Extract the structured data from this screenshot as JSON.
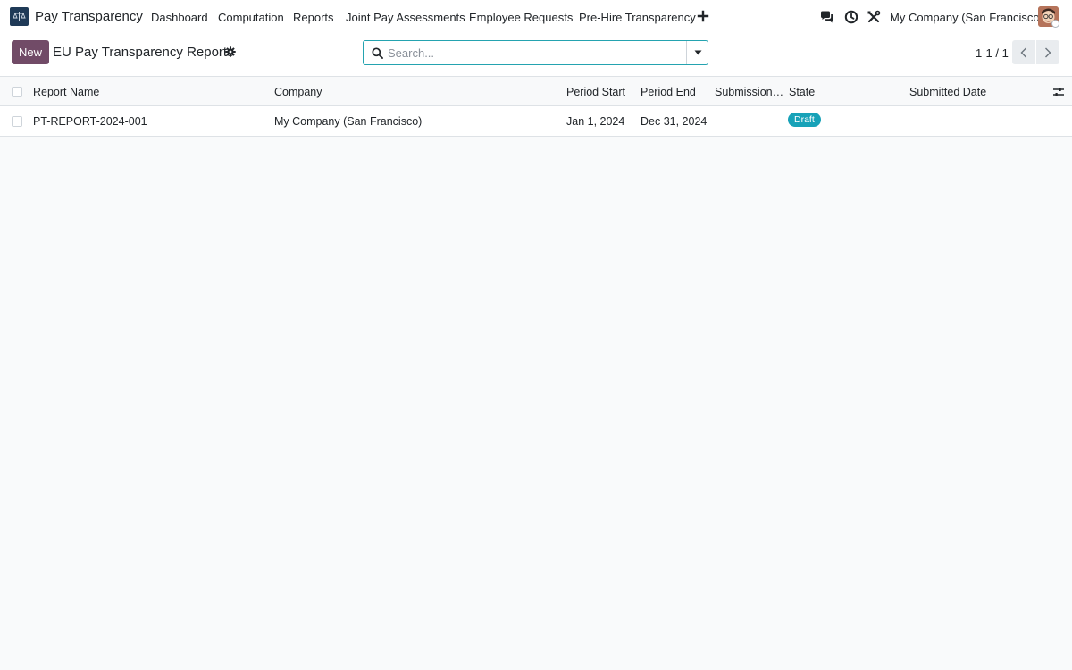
{
  "app": {
    "name": "Pay Transparency",
    "logo_icon": "scales-icon"
  },
  "menu": {
    "items": [
      {
        "label": "Dashboard"
      },
      {
        "label": "Computation"
      },
      {
        "label": "Reports"
      },
      {
        "label": "Joint Pay Assessments"
      },
      {
        "label": "Employee Requests"
      },
      {
        "label": "Pre-Hire Transparency"
      }
    ]
  },
  "systray": {
    "company": "My Company (San Francisco)"
  },
  "control": {
    "new_label": "New",
    "title": "EU Pay Transparency Reports",
    "search_placeholder": "Search...",
    "pager": "1-1 / 1"
  },
  "table": {
    "columns": [
      "Report Name",
      "Company",
      "Period Start",
      "Period End",
      "Submission…",
      "State",
      "Submitted Date"
    ],
    "rows": [
      {
        "report_name": "PT-REPORT-2024-001",
        "company": "My Company (San Francisco)",
        "period_start": "Jan 1, 2024",
        "period_end": "Dec 31, 2024",
        "submission": "",
        "state": "Draft",
        "submitted_date": ""
      }
    ]
  },
  "colors": {
    "primary": "#714b67",
    "accent": "#24a3b0",
    "badge_info": "#17a2b8",
    "background": "#f9fafb"
  }
}
